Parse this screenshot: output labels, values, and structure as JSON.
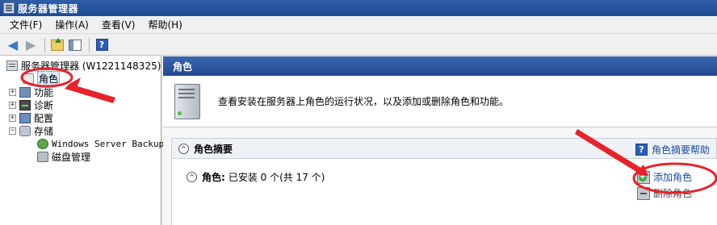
{
  "window": {
    "title": "服务器管理器"
  },
  "menu": [
    "文件(F)",
    "操作(A)",
    "查看(V)",
    "帮助(H)"
  ],
  "toolbar": {
    "icons": [
      "back-arrow-icon",
      "forward-arrow-icon",
      "up-folder-icon",
      "show-hide-pane-icon",
      "help-icon"
    ],
    "help_glyph": "?"
  },
  "tree": {
    "root_label": "服务器管理器 (W1221148325)",
    "roles_label": "角色",
    "features_label": "功能",
    "diagnostics_label": "诊断",
    "configuration_label": "配置",
    "storage_label": "存储",
    "backup_label": "Windows Server Backup",
    "disk_label": "磁盘管理",
    "expander_plus": "+",
    "expander_minus": "−"
  },
  "main": {
    "header": "角色",
    "intro": "查看安装在服务器上角色的运行状况，以及添加或删除角色和功能。",
    "summary_title": "角色摘要",
    "summary_help": "角色摘要帮助",
    "roles_label": "角色:",
    "roles_status": "已安装 0 个(共 17 个)",
    "add_roles": "添加角色",
    "remove_roles": "删除角色",
    "collapse_glyph": "^"
  },
  "colors": {
    "title_bar": "#1c4b93",
    "header_bar": "#2a57a3",
    "annotation": "#e8222a",
    "link": "#1a4aa0"
  }
}
